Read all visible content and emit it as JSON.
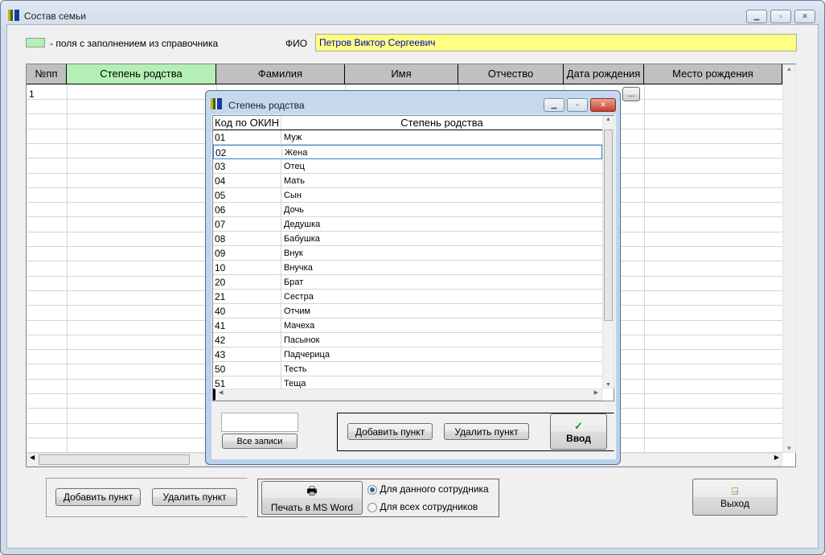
{
  "main_window": {
    "title": "Состав семьи",
    "legend_text": "- поля с заполнением из справочника",
    "fio_label": "ФИО",
    "fio_value": "Петров Виктор Сергеевич",
    "legend_color": "#b4f0b4",
    "fio_bg": "#ffff80"
  },
  "main_grid": {
    "columns": [
      "№пп",
      "Степень родства",
      "Фамилия",
      "Имя",
      "Отчество",
      "Дата рождения",
      "Место рождения"
    ],
    "rows": [
      {
        "num": "1"
      }
    ],
    "ellipsis": "..."
  },
  "main_buttons": {
    "add": "Добавить пункт",
    "delete": "Удалить пункт",
    "print": "Печать в MS Word",
    "radio_this": "Для данного сотрудника",
    "radio_all": "Для всех сотрудников",
    "exit": "Выход"
  },
  "dialog": {
    "title": "Степень родства",
    "columns": [
      "Код по ОКИН",
      "Степень родства"
    ],
    "rows": [
      [
        "01",
        "Муж"
      ],
      [
        "02",
        "Жена"
      ],
      [
        "03",
        "Отец"
      ],
      [
        "04",
        "Мать"
      ],
      [
        "05",
        "Сын"
      ],
      [
        "06",
        "Дочь"
      ],
      [
        "07",
        "Дедушка"
      ],
      [
        "08",
        "Бабушка"
      ],
      [
        "09",
        "Внук"
      ],
      [
        "10",
        "Внучка"
      ],
      [
        "20",
        "Брат"
      ],
      [
        "21",
        "Сестра"
      ],
      [
        "40",
        "Отчим"
      ],
      [
        "41",
        "Мачеха"
      ],
      [
        "42",
        "Пасынок"
      ],
      [
        "43",
        "Падчерица"
      ],
      [
        "50",
        "Тесть"
      ],
      [
        "51",
        "Теща"
      ]
    ],
    "selected_index": 1,
    "search_value": "",
    "all_records": "Все записи",
    "add": "Добавить пункт",
    "delete": "Удалить пункт",
    "ok": "Ввод"
  }
}
